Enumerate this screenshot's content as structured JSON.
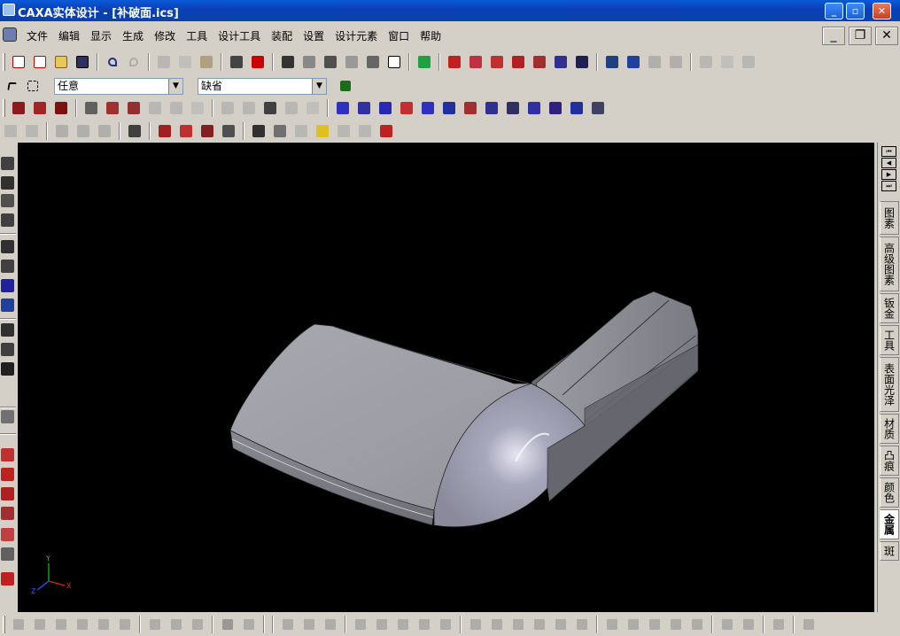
{
  "window": {
    "title": "CAXA实体设计 - [补破面.ics]",
    "minimize": "_",
    "maximize": "▫",
    "close": "✕"
  },
  "menu": {
    "items": [
      "文件",
      "编辑",
      "显示",
      "生成",
      "修改",
      "工具",
      "设计工具",
      "装配",
      "设置",
      "设计元素",
      "窗口",
      "帮助"
    ],
    "mdi_minimize": "_",
    "mdi_restore": "❐",
    "mdi_close": "✕"
  },
  "toolbar2": {
    "select_filter": "任意",
    "style_combo": "缺省"
  },
  "viewport": {
    "background": "#000000",
    "axes": {
      "x": "X",
      "y": "Y",
      "z": "Z"
    }
  },
  "right_tabs": [
    "图素",
    "高级图素",
    "钣金",
    "工具",
    "表面光泽",
    "材质",
    "凸痕",
    "颜色",
    "金属",
    "斑"
  ],
  "right_tabs_active": "金属",
  "right_nav": [
    "⏮",
    "◀",
    "▶",
    "⏭"
  ]
}
